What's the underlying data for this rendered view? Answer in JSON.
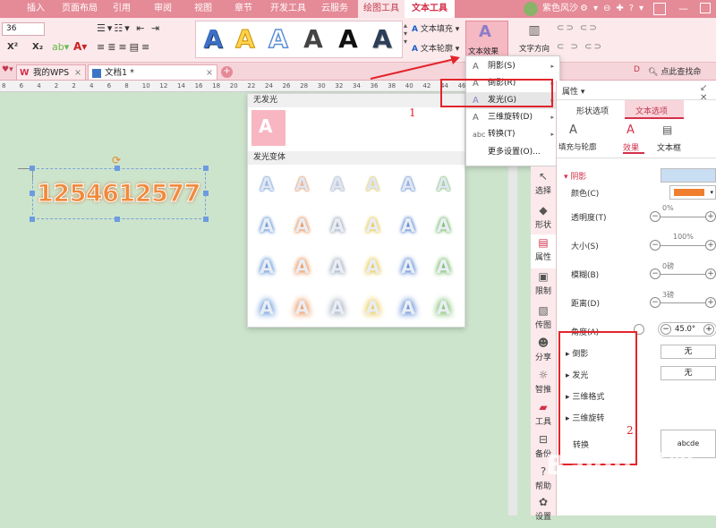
{
  "top_tabs": [
    "插入",
    "页面布局",
    "引用",
    "审阅",
    "视图",
    "章节",
    "开发工具",
    "云服务",
    "绘图工具",
    "文本工具"
  ],
  "user": {
    "name": "紫色风沙"
  },
  "ribbon": {
    "font_size": "36",
    "text_fill": "文本填充",
    "text_outline": "文本轮廓",
    "text_effect": "文本效果",
    "text_direction": "文字方向"
  },
  "doc_tabs": {
    "wps": "我的WPS",
    "doc": "文档1 *",
    "search": "点此查找命"
  },
  "ruler_numbers": [
    "8",
    "6",
    "4",
    "2",
    "2",
    "4",
    "6",
    "8",
    "10",
    "12",
    "14",
    "16",
    "18",
    "20",
    "22",
    "24",
    "26",
    "28",
    "30",
    "32",
    "34",
    "36",
    "38",
    "40",
    "42",
    "44",
    "46",
    "48"
  ],
  "document": {
    "text": "1254612577"
  },
  "menu": {
    "items": [
      {
        "label": "阴影(S)",
        "arrow": true
      },
      {
        "label": "倒影(R)",
        "arrow": true
      },
      {
        "label": "发光(G)",
        "arrow": true
      },
      {
        "label": "三维旋转(D)",
        "arrow": true
      },
      {
        "label": "转换(T)",
        "arrow": true
      },
      {
        "label": "更多设置(O)...",
        "arrow": false
      }
    ]
  },
  "glow_panel": {
    "no_glow": "无发光",
    "variants": "发光变体",
    "annotation1": "1"
  },
  "glow_colors": [
    "#5b8fd6",
    "#e98b4b",
    "#9aa6b9",
    "#e6c547",
    "#4f7fd1",
    "#6fb85f"
  ],
  "vertical_bar": [
    "选择",
    "形状",
    "属性",
    "限制",
    "传图",
    "分享",
    "智推",
    "工具",
    "备份",
    "帮助",
    "设置"
  ],
  "props": {
    "title": "属性",
    "tab_shape": "形状选项",
    "tab_text": "文本选项",
    "sub_fill": "填充与轮廓",
    "sub_effect": "效果",
    "sub_textbox": "文本框",
    "shadow": "阴影",
    "color": "颜色(C)",
    "transparency": "透明度(T)",
    "transparency_val": "0%",
    "size": "大小(S)",
    "size_val": "100%",
    "blur": "模糊(B)",
    "blur_val": "0磅",
    "distance": "距离(D)",
    "distance_val": "3磅",
    "angle": "角度(A)",
    "angle_val": "45.0°",
    "reflection": "倒影",
    "reflection_val": "无",
    "glow": "发光",
    "glow_val": "无",
    "threed_format": "三维格式",
    "threed_rotate": "三维旋转",
    "transform": "转换",
    "transform_val": "abcde",
    "annotation2": "2"
  },
  "watermark": {
    "main": "Baidu 经验",
    "sub": "jingyan.baidu.com"
  }
}
